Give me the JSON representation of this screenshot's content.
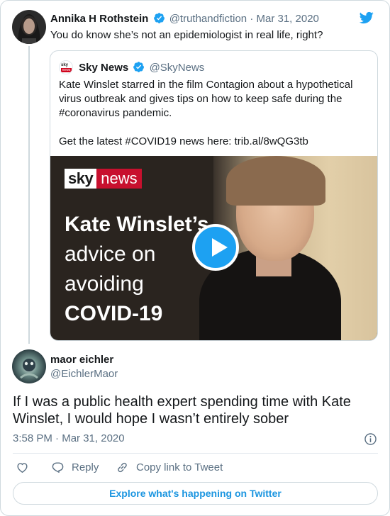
{
  "colors": {
    "twitter_blue": "#1da1f2",
    "link_blue": "#1b95e0",
    "muted_text": "#5b7083",
    "sky_red": "#c8102e"
  },
  "tweet_parent": {
    "author_name": "Annika H Rothstein",
    "author_handle": "@truthandfiction",
    "separator": "·",
    "date": "Mar 31, 2020",
    "verified": true,
    "text": "You do know she’s not an epidemiologist in real life, right?",
    "icons": [
      "verified-badge-icon",
      "twitter-bird-icon"
    ]
  },
  "quoted_tweet": {
    "author_name": "Sky News",
    "author_handle": "@SkyNews",
    "avatar_text_top": "sky",
    "avatar_text_bottom": "news",
    "verified": true,
    "lines": [
      "Kate Winslet starred in the film Contagion about a hypothetical",
      "virus outbreak and gives tips on how to keep safe during the",
      "#coronavirus pandemic.",
      "Get the latest #COVID19 news here: trib.al/8wQG3tb"
    ],
    "media": {
      "logo_sky": "sky",
      "logo_news": "news",
      "headline_lines": [
        "Kate Winslet’s",
        "advice on",
        "avoiding",
        "COVID-19"
      ],
      "play_icon": "play-icon"
    }
  },
  "reply": {
    "author_name": "maor eichler",
    "author_handle": "@EichlerMaor",
    "text": "If I was a public health expert spending time with Kate Winslet, I would hope I wasn’t entirely sober",
    "time": "3:58 PM",
    "separator": "·",
    "date": "Mar 31, 2020"
  },
  "actions": {
    "like_icon": "heart-icon",
    "reply_label": "Reply",
    "copy_label": "Copy link to Tweet"
  },
  "footer": {
    "explore_label": "Explore what's happening on Twitter"
  }
}
